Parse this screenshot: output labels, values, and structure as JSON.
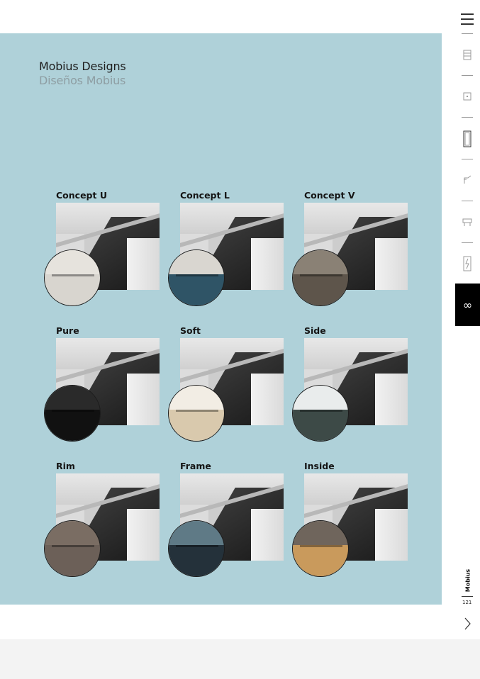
{
  "header": {
    "title_en": "Mobius Designs",
    "title_es": "Diseños Mobius"
  },
  "designs": [
    {
      "label": "Concept U",
      "detail_top": "#e6e3dd",
      "detail_bottom": "#d8d5cf"
    },
    {
      "label": "Concept L",
      "detail_top": "#d9d6d0",
      "detail_bottom": "#2f5466"
    },
    {
      "label": "Concept V",
      "detail_top": "#8a8175",
      "detail_bottom": "#5e554b"
    },
    {
      "label": "Pure",
      "detail_top": "#2a2a2a",
      "detail_bottom": "#111111"
    },
    {
      "label": "Soft",
      "detail_top": "#f2ede4",
      "detail_bottom": "#d9c9ad"
    },
    {
      "label": "Side",
      "detail_top": "#e9ecec",
      "detail_bottom": "#3d4a47"
    },
    {
      "label": "Rim",
      "detail_top": "#7a6d63",
      "detail_bottom": "#6c6058"
    },
    {
      "label": "Frame",
      "detail_top": "#5f7a86",
      "detail_bottom": "#24313a"
    },
    {
      "label": "Inside",
      "detail_top": "#6f655c",
      "detail_bottom": "#c99a5c"
    }
  ],
  "sidebar": {
    "icons": [
      "cabinet-icon",
      "drawer-icon",
      "mirror-icon",
      "tap-icon",
      "furniture-icon",
      "light-icon"
    ],
    "active_icon": "infinity-icon",
    "active_symbol": "∞",
    "section_label": "Mobius",
    "page_number": "121"
  },
  "colors": {
    "panel": "#afd1d9",
    "active_tab": "#000000"
  }
}
